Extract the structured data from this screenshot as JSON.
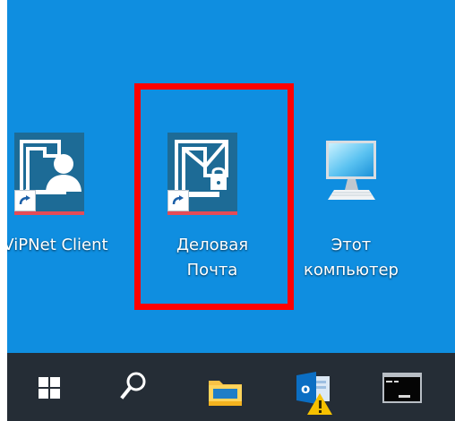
{
  "desktop": {
    "background_color": "#0f8ee0",
    "icons": [
      {
        "label": "ViPNet Client",
        "icon": "vipnet-client-user-icon"
      },
      {
        "label_lines": [
          "Деловая",
          "Почта"
        ],
        "icon": "business-mail-lock-icon",
        "highlighted": true
      },
      {
        "label_lines": [
          "Этот",
          "компьютер"
        ],
        "icon": "this-pc-monitor-icon"
      }
    ],
    "highlight_color": "#ff0000"
  },
  "taskbar": {
    "background_color": "#252d36",
    "items": [
      {
        "icon": "windows-start-icon"
      },
      {
        "icon": "search-icon"
      },
      {
        "icon": "file-explorer-icon"
      },
      {
        "icon": "outlook-warning-icon"
      },
      {
        "icon": "command-prompt-icon"
      }
    ]
  }
}
